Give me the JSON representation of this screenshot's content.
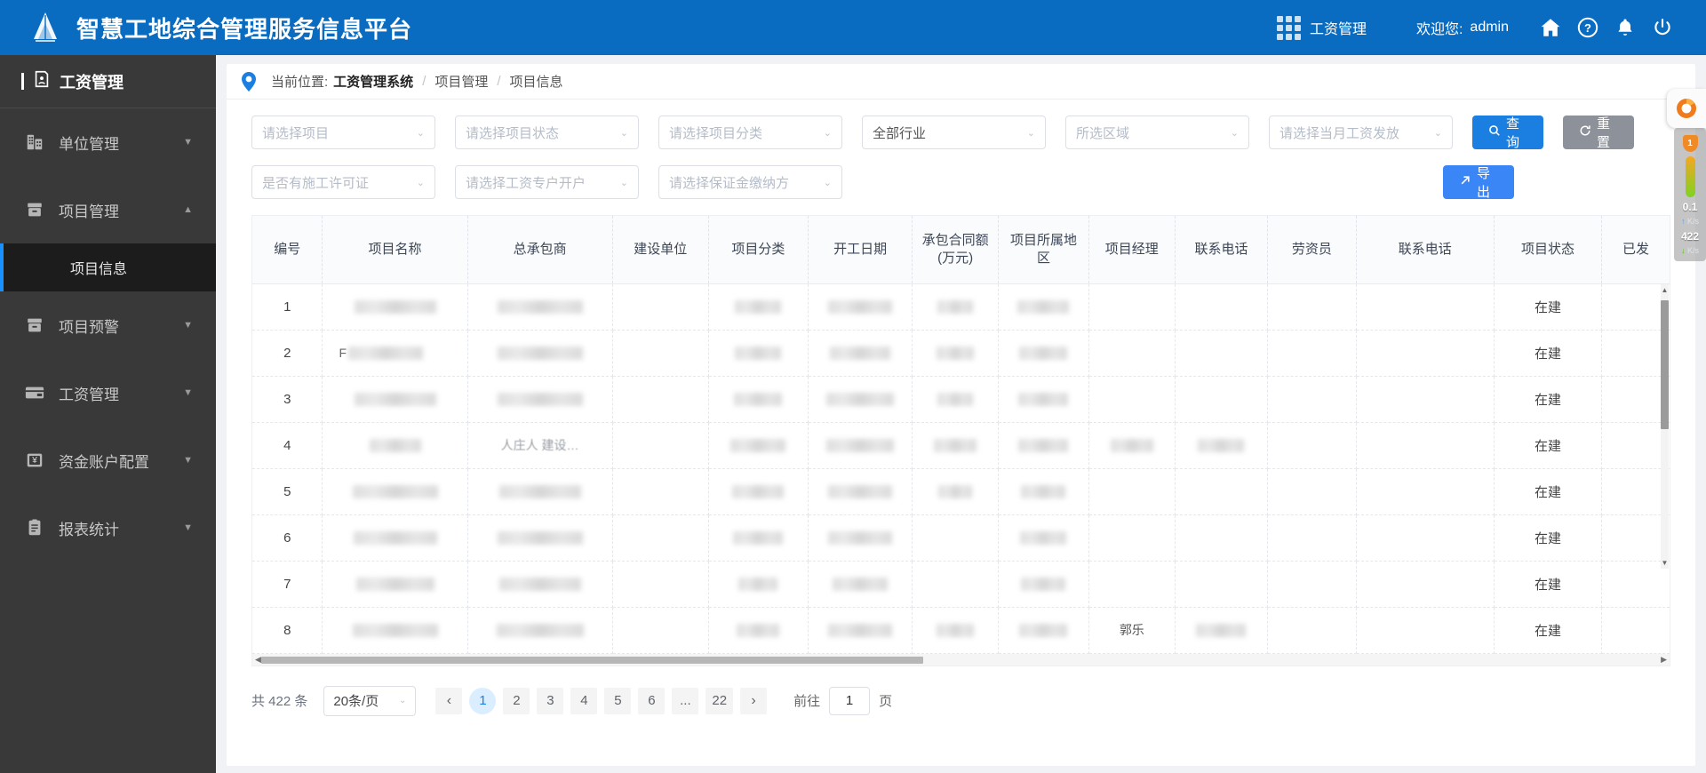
{
  "header": {
    "title": "智慧工地综合管理服务信息平台",
    "module_label": "工资管理",
    "welcome_label": "欢迎您:",
    "user": "admin",
    "icons": [
      "grid-icon",
      "home-icon",
      "help-icon",
      "bell-icon",
      "power-icon"
    ]
  },
  "sidebar": {
    "title": "工资管理",
    "items": [
      {
        "label": "单位管理",
        "icon": "building-icon",
        "expanded": false
      },
      {
        "label": "项目管理",
        "icon": "folder-icon",
        "expanded": true
      },
      {
        "label": "项目预警",
        "icon": "folder-icon",
        "expanded": false
      },
      {
        "label": "工资管理",
        "icon": "card-icon",
        "expanded": false
      },
      {
        "label": "资金账户配置",
        "icon": "yuan-icon",
        "expanded": false
      },
      {
        "label": "报表统计",
        "icon": "clipboard-icon",
        "expanded": false
      }
    ],
    "sub_item": "项目信息"
  },
  "breadcrumb": {
    "prefix": "当前位置:",
    "root": "工资管理系统",
    "sep": "/",
    "level2": "项目管理",
    "level3": "项目信息"
  },
  "filters": {
    "row1": [
      {
        "placeholder": "请选择项目",
        "name": "project-select"
      },
      {
        "placeholder": "请选择项目状态",
        "name": "project-status-select"
      },
      {
        "placeholder": "请选择项目分类",
        "name": "project-category-select"
      },
      {
        "placeholder": "全部行业",
        "name": "industry-select"
      },
      {
        "placeholder": "所选区域",
        "name": "region-select"
      },
      {
        "placeholder": "请选择当月工资发放",
        "name": "monthly-salary-select"
      }
    ],
    "row2": [
      {
        "placeholder": "是否有施工许可证",
        "name": "construction-permit-select"
      },
      {
        "placeholder": "请选择工资专户开户",
        "name": "salary-account-select"
      },
      {
        "placeholder": "请选择保证金缴纳方",
        "name": "deposit-payer-select"
      }
    ],
    "query_button": "查询",
    "reset_button": "重置",
    "export_button": "导出"
  },
  "table": {
    "columns": [
      "编号",
      "项目名称",
      "总承包商",
      "建设单位",
      "项目分类",
      "开工日期",
      "承包合同额(万元)",
      "项目所属地区",
      "项目经理",
      "联系电话",
      "劳资员",
      "联系电话",
      "项目状态",
      "已发"
    ],
    "rows": [
      {
        "no": "1",
        "status": "在建",
        "manager": "",
        "laborer": "",
        "name_prefix": ""
      },
      {
        "no": "2",
        "status": "在建",
        "manager": "",
        "laborer": "",
        "name_prefix": "F"
      },
      {
        "no": "3",
        "status": "在建",
        "manager": "",
        "laborer": "",
        "name_prefix": ""
      },
      {
        "no": "4",
        "status": "在建",
        "manager": "",
        "laborer": "",
        "name_prefix": "",
        "contractor_hint": "人庄人  建设…"
      },
      {
        "no": "5",
        "status": "在建",
        "manager": "",
        "laborer": "",
        "name_prefix": ""
      },
      {
        "no": "6",
        "status": "在建",
        "manager": "",
        "laborer": "",
        "name_prefix": ""
      },
      {
        "no": "7",
        "status": "在建",
        "manager": "",
        "laborer": "",
        "name_prefix": ""
      },
      {
        "no": "8",
        "status": "在建",
        "manager": "郭乐",
        "laborer": "",
        "name_prefix": ""
      }
    ]
  },
  "pager": {
    "total_text": "共 422 条",
    "page_size": "20条/页",
    "pages": [
      "1",
      "2",
      "3",
      "4",
      "5",
      "6",
      "...",
      "22"
    ],
    "current": "1",
    "prev": "‹",
    "next": "›",
    "goto_label": "前往",
    "goto_value": "1",
    "goto_unit": "页"
  },
  "floater": {
    "badge": "1",
    "up_value": "0.1",
    "up_unit": "K/s",
    "down_value": "422",
    "down_unit": "K/s"
  },
  "colors": {
    "brand_blue": "#0a6cc1",
    "accent": "#1a7fe0",
    "sidebar_bg": "#393939",
    "sidebar_active": "#1c1c1c"
  }
}
